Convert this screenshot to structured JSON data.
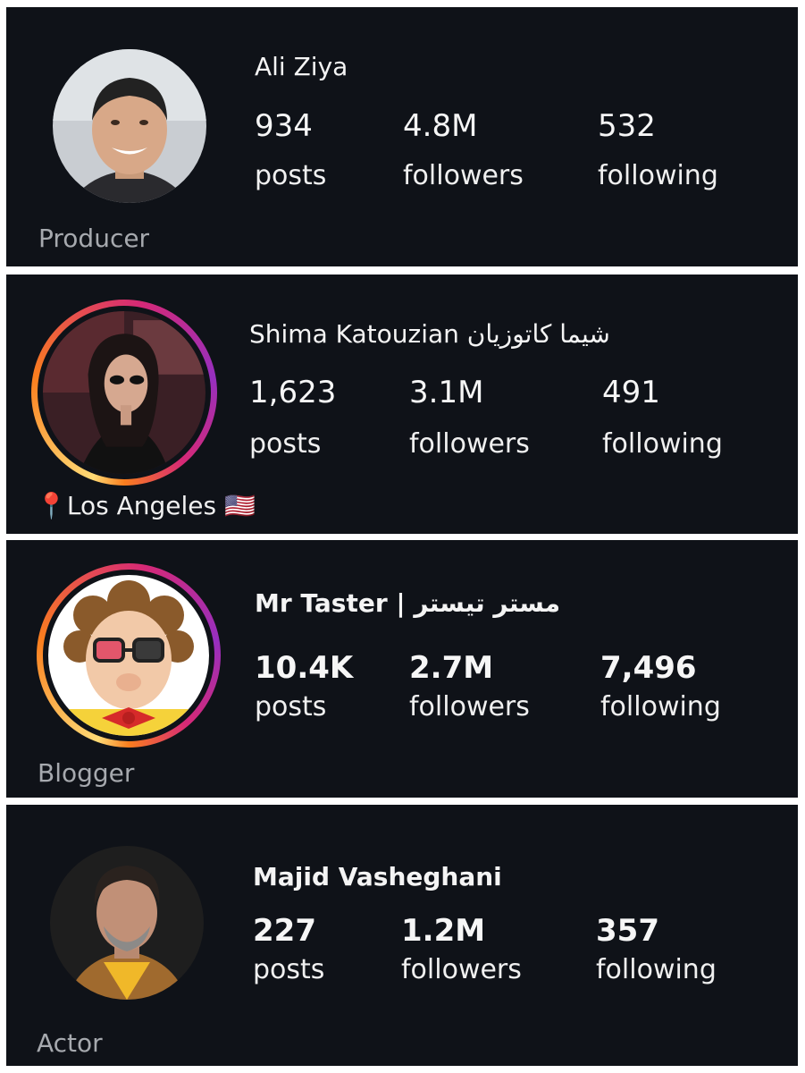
{
  "profiles": [
    {
      "name": "Ali Ziya",
      "stats": [
        {
          "value": "934",
          "label": "posts"
        },
        {
          "value": "4.8M",
          "label": "followers"
        },
        {
          "value": "532",
          "label": "following"
        }
      ],
      "category": "Producer"
    },
    {
      "name": "Shima Katouzian شیما کاتوزیان",
      "stats": [
        {
          "value": "1,623",
          "label": "posts"
        },
        {
          "value": "3.1M",
          "label": "followers"
        },
        {
          "value": "491",
          "label": "following"
        }
      ],
      "category": "📍Los Angeles 🇺🇸"
    },
    {
      "name": "Mr Taster | مستر تیستر",
      "stats": [
        {
          "value": "10.4K",
          "label": "posts"
        },
        {
          "value": "2.7M",
          "label": "followers"
        },
        {
          "value": "7,496",
          "label": "following"
        }
      ],
      "category": "Blogger"
    },
    {
      "name": "Majid Vasheghani",
      "stats": [
        {
          "value": "227",
          "label": "posts"
        },
        {
          "value": "1.2M",
          "label": "followers"
        },
        {
          "value": "357",
          "label": "following"
        }
      ],
      "category": "Actor"
    }
  ],
  "colors": {
    "card_bg": "#0f1218",
    "category_text": "#a6a9ae",
    "story_ring": [
      "#feda75",
      "#fa7e1e",
      "#d62976",
      "#962fbf"
    ]
  }
}
